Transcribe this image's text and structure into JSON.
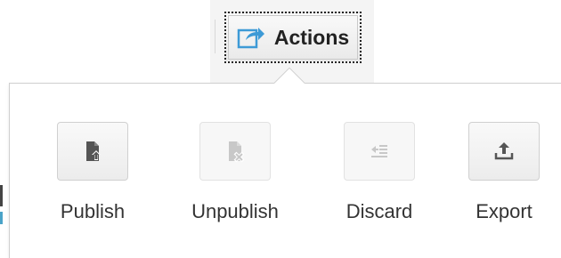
{
  "toolbar": {
    "actions_label": "Actions",
    "actions_icon": "share-arrow-icon"
  },
  "menu": {
    "items": [
      {
        "label": "Publish",
        "icon": "publish-icon",
        "enabled": true
      },
      {
        "label": "Unpublish",
        "icon": "unpublish-icon",
        "enabled": false
      },
      {
        "label": "Discard",
        "icon": "discard-icon",
        "enabled": false
      },
      {
        "label": "Export",
        "icon": "export-icon",
        "enabled": true
      }
    ]
  },
  "colors": {
    "accent": "#3d9ad6",
    "icon_active": "#555555",
    "icon_disabled": "#c8c8c8"
  }
}
